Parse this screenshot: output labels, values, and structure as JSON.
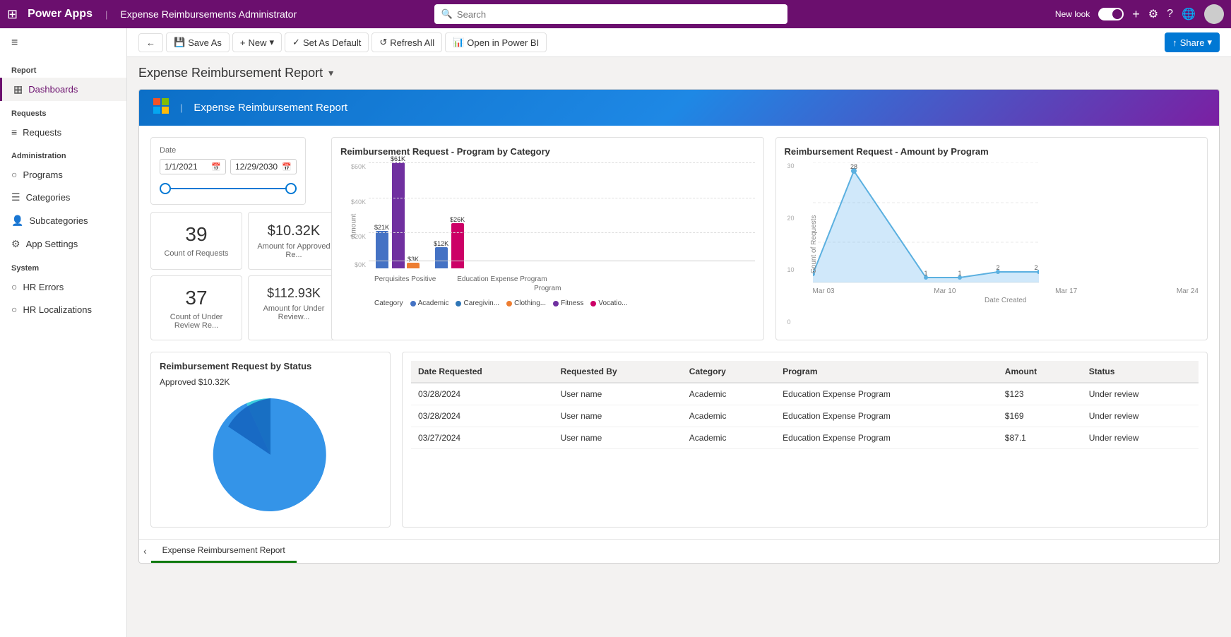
{
  "topnav": {
    "app_name": "Power Apps",
    "separator": "|",
    "page_title": "Expense Reimbursements Administrator",
    "search_placeholder": "Search",
    "new_look_label": "New look",
    "icons": {
      "grid": "⊞",
      "plus": "+",
      "gear": "⚙",
      "help": "?",
      "globe": "🌐"
    }
  },
  "toolbar": {
    "back_icon": "←",
    "save_as_label": "Save As",
    "new_label": "New",
    "set_default_label": "Set As Default",
    "refresh_label": "Refresh All",
    "open_pbi_label": "Open in Power BI",
    "share_label": "Share"
  },
  "report_title": "Expense Reimbursement Report",
  "sidebar": {
    "hamburger": "≡",
    "sections": [
      {
        "name": "Report",
        "items": [
          {
            "id": "dashboards",
            "label": "Dashboards",
            "icon": "▦",
            "active": true
          }
        ]
      },
      {
        "name": "Requests",
        "items": [
          {
            "id": "requests",
            "label": "Requests",
            "icon": "≡"
          }
        ]
      },
      {
        "name": "Administration",
        "items": [
          {
            "id": "programs",
            "label": "Programs",
            "icon": "○"
          },
          {
            "id": "categories",
            "label": "Categories",
            "icon": "☰"
          },
          {
            "id": "subcategories",
            "label": "Subcategories",
            "icon": "👤"
          },
          {
            "id": "app-settings",
            "label": "App Settings",
            "icon": "⚙"
          }
        ]
      },
      {
        "name": "System",
        "items": [
          {
            "id": "hr-errors",
            "label": "HR Errors",
            "icon": "○"
          },
          {
            "id": "hr-localizations",
            "label": "HR Localizations",
            "icon": "○"
          }
        ]
      }
    ]
  },
  "report_banner": {
    "logo": "🟧🟦",
    "separator": "|",
    "title": "Expense Reimbursement Report"
  },
  "date_filter": {
    "label": "Date",
    "start_date": "1/1/2021",
    "end_date": "12/29/2030"
  },
  "kpis": [
    {
      "value": "39",
      "label": "Count of Requests"
    },
    {
      "value": "$10.32K",
      "label": "Amount for Approved Re..."
    },
    {
      "value": "37",
      "label": "Count of Under Review Re..."
    },
    {
      "value": "$112.93K",
      "label": "Amount for Under Review..."
    }
  ],
  "bar_chart": {
    "title": "Reimbursement Request - Program by Category",
    "y_labels": [
      "$60K",
      "$40K",
      "$20K",
      "$0K"
    ],
    "x_labels": [
      "Perquisites Positive",
      "Education Expense Program"
    ],
    "groups": [
      {
        "x_label": "Perquisites Positive",
        "bars": [
          {
            "color": "#4472c4",
            "height_pct": 35,
            "value": "$21K"
          },
          {
            "color": "#7030a0",
            "height_pct": 100,
            "value": "$61K"
          },
          {
            "color": "#ed7d31",
            "height_pct": 5,
            "value": "$3K"
          }
        ]
      },
      {
        "x_label": "Education Expense Program",
        "bars": [
          {
            "color": "#4472c4",
            "height_pct": 20,
            "value": "$12K"
          },
          {
            "color": "#cc0066",
            "height_pct": 43,
            "value": "$26K"
          }
        ]
      }
    ],
    "legend": [
      {
        "label": "Academic",
        "color": "#4472c4"
      },
      {
        "label": "Caregivin...",
        "color": "#2e75b6"
      },
      {
        "label": "Clothing...",
        "color": "#ed7d31"
      },
      {
        "label": "Fitness",
        "color": "#7030a0"
      },
      {
        "label": "Vocatio...",
        "color": "#cc0066"
      }
    ]
  },
  "line_chart": {
    "title": "Reimbursement Request - Amount by Program",
    "x_axis_label": "Date Created",
    "y_axis_label": "Count of Requests",
    "x_labels": [
      "Mar 03",
      "Mar 10",
      "Mar 17",
      "Mar 24"
    ],
    "y_max": 30,
    "peak_value": 28,
    "data_points": [
      {
        "x_pct": 0,
        "y": 2,
        "label": "2"
      },
      {
        "x_pct": 18,
        "y": 28,
        "label": "28"
      },
      {
        "x_pct": 50,
        "y": 1,
        "label": "1"
      },
      {
        "x_pct": 65,
        "y": 1,
        "label": "1"
      },
      {
        "x_pct": 82,
        "y": 2,
        "label": "2"
      },
      {
        "x_pct": 100,
        "y": 2,
        "label": "2"
      }
    ]
  },
  "pie_chart": {
    "title": "Reimbursement Request by Status",
    "approved_label": "Approved $10.32K"
  },
  "table": {
    "columns": [
      "Date Requested",
      "Requested By",
      "Category",
      "Program",
      "Amount",
      "Status"
    ],
    "rows": [
      {
        "date": "03/28/2024",
        "requested_by": "User name",
        "category": "Academic",
        "program": "Education Expense Program",
        "amount": "$123",
        "status": "Under review"
      },
      {
        "date": "03/28/2024",
        "requested_by": "User name",
        "category": "Academic",
        "program": "Education Expense Program",
        "amount": "$169",
        "status": "Under review"
      },
      {
        "date": "03/27/2024",
        "requested_by": "User name",
        "category": "Academic",
        "program": "Education Expense Program",
        "amount": "$87.1",
        "status": "Under review"
      }
    ]
  },
  "report_tabs": [
    {
      "label": "Expense Reimbursement Report",
      "active": true
    }
  ],
  "colors": {
    "purple_brand": "#6b0f6e",
    "blue_accent": "#0078d4",
    "green_tab": "#0f7b0f"
  }
}
